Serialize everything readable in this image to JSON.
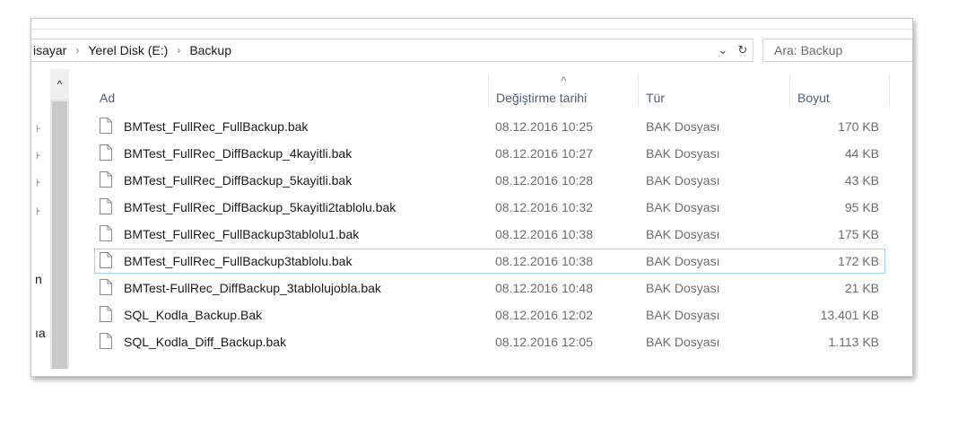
{
  "address": {
    "crumbs": [
      "isayar",
      "Yerel Disk (E:)",
      "Backup"
    ],
    "separator": "›",
    "dropdown_glyph": "⌄",
    "refresh_glyph": "↻"
  },
  "search": {
    "placeholder": "Ara: Backup"
  },
  "nav": {
    "scroll_up_glyph": "^",
    "pin_glyph": "⊦",
    "letters": [
      "n",
      "ıa"
    ]
  },
  "columns": {
    "name": "Ad",
    "modified": "Değiştirme tarihi",
    "type": "Tür",
    "size": "Boyut",
    "sort_glyph": "^"
  },
  "files": [
    {
      "name": "BMTest_FullRec_FullBackup.bak",
      "modified": "08.12.2016 10:25",
      "type": "BAK Dosyası",
      "size": "170 KB",
      "selected": false
    },
    {
      "name": "BMTest_FullRec_DiffBackup_4kayitli.bak",
      "modified": "08.12.2016 10:27",
      "type": "BAK Dosyası",
      "size": "44 KB",
      "selected": false
    },
    {
      "name": "BMTest_FullRec_DiffBackup_5kayitli.bak",
      "modified": "08.12.2016 10:28",
      "type": "BAK Dosyası",
      "size": "43 KB",
      "selected": false
    },
    {
      "name": "BMTest_FullRec_DiffBackup_5kayitli2tablolu.bak",
      "modified": "08.12.2016 10:32",
      "type": "BAK Dosyası",
      "size": "95 KB",
      "selected": false
    },
    {
      "name": "BMTest_FullRec_FullBackup3tablolu1.bak",
      "modified": "08.12.2016 10:38",
      "type": "BAK Dosyası",
      "size": "175 KB",
      "selected": false
    },
    {
      "name": "BMTest_FullRec_FullBackup3tablolu.bak",
      "modified": "08.12.2016 10:38",
      "type": "BAK Dosyası",
      "size": "172 KB",
      "selected": true
    },
    {
      "name": "BMTest-FullRec_DiffBackup_3tablolujobla.bak",
      "modified": "08.12.2016 10:48",
      "type": "BAK Dosyası",
      "size": "21 KB",
      "selected": false
    },
    {
      "name": "SQL_Kodla_Backup.Bak",
      "modified": "08.12.2016 12:02",
      "type": "BAK Dosyası",
      "size": "13.401 KB",
      "selected": false
    },
    {
      "name": "SQL_Kodla_Diff_Backup.bak",
      "modified": "08.12.2016 12:05",
      "type": "BAK Dosyası",
      "size": "1.113 KB",
      "selected": false
    }
  ],
  "icons": {
    "file": "file-icon",
    "chevron": "chevron-right-icon",
    "refresh": "refresh-icon",
    "dropdown": "chevron-down-icon"
  },
  "colors": {
    "selection_border": "#99d1ff",
    "header_text": "#4c607a",
    "secondary_text": "#6d6d6d"
  }
}
